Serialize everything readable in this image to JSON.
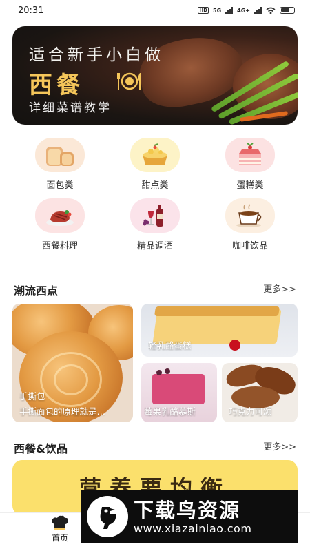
{
  "status_bar": {
    "time": "20:31",
    "hd_label": "HD",
    "net1": "5G",
    "net2": "4G+"
  },
  "banner": {
    "line1": "适合新手小白做",
    "line2": "西餐",
    "line3": "详细菜谱教学"
  },
  "categories": [
    {
      "label": "面包类",
      "icon": "bread-icon"
    },
    {
      "label": "甜点类",
      "icon": "tart-icon"
    },
    {
      "label": "蛋糕类",
      "icon": "cake-icon"
    },
    {
      "label": "西餐料理",
      "icon": "steak-icon"
    },
    {
      "label": "精品调酒",
      "icon": "wine-icon"
    },
    {
      "label": "咖啡饮品",
      "icon": "coffee-icon"
    }
  ],
  "section1": {
    "title": "潮流西点",
    "more": "更多>>",
    "cards": [
      {
        "tag": "手撕包",
        "caption": "手撕面包的原理就是…"
      },
      {
        "caption": "轻乳酪蛋糕"
      },
      {
        "caption": "莓果乳酪慕斯"
      },
      {
        "caption": "巧克力可颂"
      }
    ]
  },
  "section2": {
    "title": "西餐&饮品",
    "more": "更多>>",
    "promo_title": "营养要均衡"
  },
  "tabbar": {
    "home_label": "首页"
  },
  "watermark": {
    "title": "下载鸟资源",
    "url": "www.xiazainiao.com"
  },
  "colors": {
    "accent": "#f5c65a",
    "promo_bg": "#fbe06c",
    "banner_dark": "#1a1512"
  }
}
